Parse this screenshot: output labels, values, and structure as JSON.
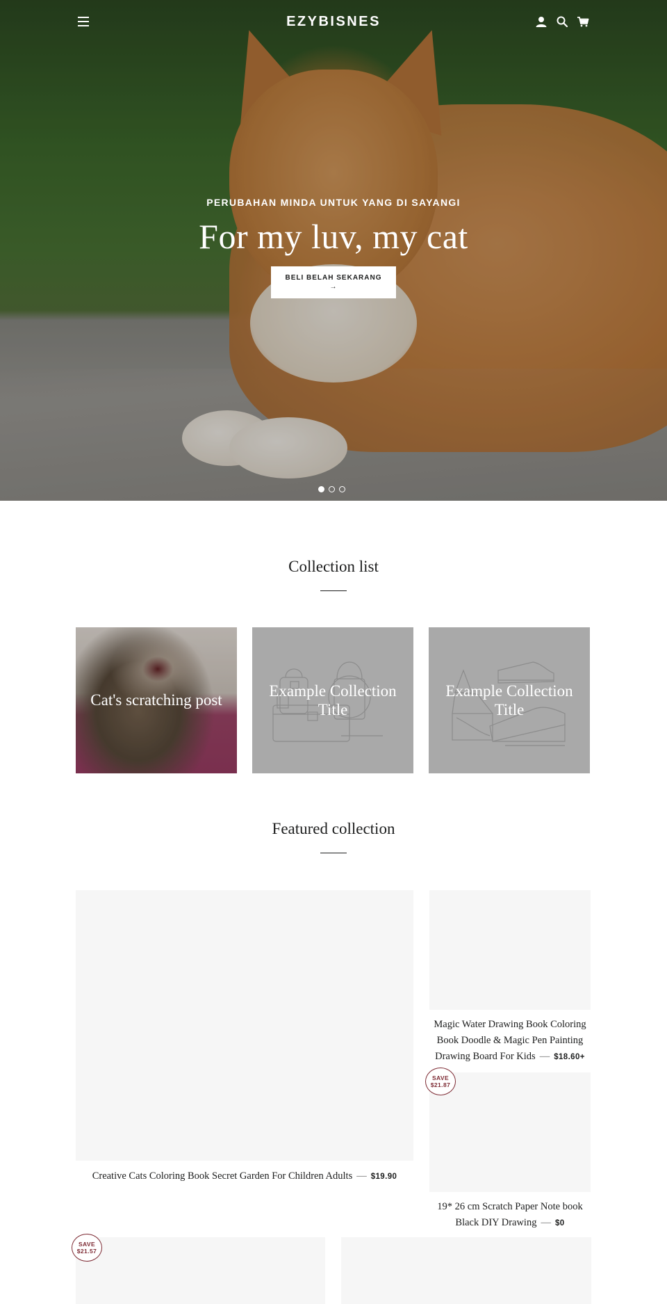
{
  "header": {
    "logo": "EZYBISNES",
    "icons": [
      "menu-icon",
      "account-icon",
      "search-icon",
      "cart-icon"
    ]
  },
  "hero": {
    "subtitle": "PERUBAHAN MINDA UNTUK YANG DI SAYANGI",
    "title": "For my luv, my cat",
    "button_label": "BELI BELAH SEKARANG",
    "button_arrow": "→",
    "slides": 3,
    "active_slide": 1
  },
  "collection_list": {
    "title": "Collection list",
    "items": [
      {
        "title": "Cat's scratching post"
      },
      {
        "title": "Example Collection Title"
      },
      {
        "title": "Example Collection Title"
      }
    ]
  },
  "featured": {
    "title": "Featured collection",
    "separator": "—",
    "products": [
      {
        "title": "Creative Cats Coloring Book Secret Garden For Children Adults",
        "price": "$19.90"
      },
      {
        "title": "Magic Water Drawing Book Coloring Book Doodle & Magic Pen Painting Drawing Board For Kids",
        "price": "$18.60+"
      },
      {
        "title": "19* 26 cm Scratch Paper Note book Black DIY Drawing",
        "price": "$0",
        "badge_label": "SAVE",
        "badge_amount": "$21.87"
      },
      {
        "badge_label": "SAVE",
        "badge_amount": "$21.57"
      },
      {}
    ]
  },
  "colors": {
    "accent_badge": "#7d2a33",
    "placeholder": "#f6f6f6",
    "collection_gray": "#a9a9a9"
  }
}
